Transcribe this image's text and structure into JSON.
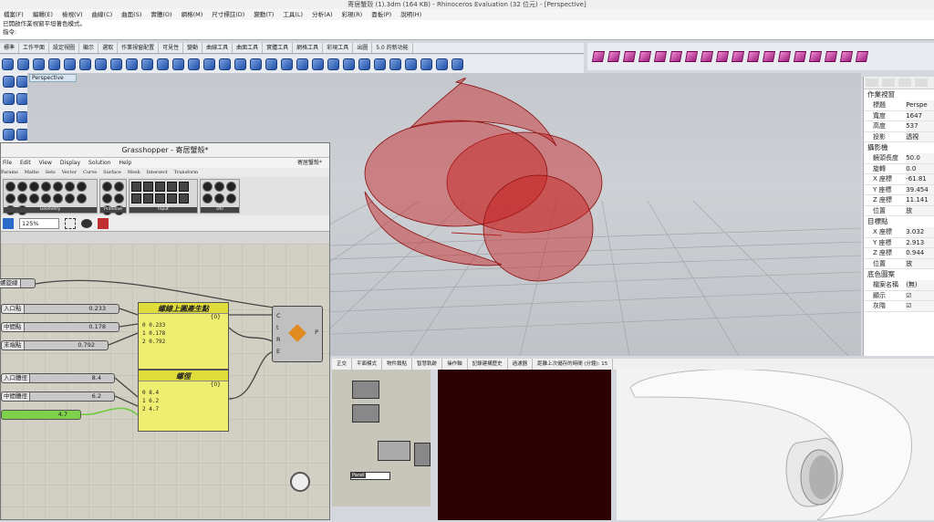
{
  "window": {
    "title": "寄居蟹殼 (1).3dm (164 KB) - Rhinoceros Evaluation (32 位元) - [Perspective]"
  },
  "menu": [
    "檔案(F)",
    "編輯(E)",
    "檢視(V)",
    "曲線(C)",
    "曲面(S)",
    "實體(O)",
    "網格(M)",
    "尺寸標註(D)",
    "變動(T)",
    "工具(L)",
    "分析(A)",
    "彩現(R)",
    "面板(P)",
    "說明(H)"
  ],
  "command": {
    "line1": "已開啟作業視窗平坦著色模式。",
    "prompt": "指令:"
  },
  "toolbar_tabs": [
    "標準",
    "工作平面",
    "設定視圖",
    "顯示",
    "選取",
    "作業視窗配置",
    "可見性",
    "變動",
    "曲線工具",
    "曲面工具",
    "實體工具",
    "網格工具",
    "彩現工具",
    "出圖",
    "5.0 的新功能"
  ],
  "viewport": {
    "label": "Perspective"
  },
  "properties": {
    "section_viewport": "作業視窗",
    "rows1": [
      {
        "k": "標題",
        "v": "Perspe"
      },
      {
        "k": "寬度",
        "v": "1647"
      },
      {
        "k": "高度",
        "v": "537"
      },
      {
        "k": "投影",
        "v": "透視"
      }
    ],
    "section_camera": "攝影機",
    "rows2": [
      {
        "k": "鏡頭長度",
        "v": "50.0"
      },
      {
        "k": "旋轉",
        "v": "0.0"
      },
      {
        "k": "X 座標",
        "v": "-61.81"
      },
      {
        "k": "Y 座標",
        "v": "39.454"
      },
      {
        "k": "Z 座標",
        "v": "11.141"
      },
      {
        "k": "位置",
        "v": "放"
      }
    ],
    "section_target": "目標點",
    "rows3": [
      {
        "k": "X 座標",
        "v": "3.032"
      },
      {
        "k": "Y 座標",
        "v": "2.913"
      },
      {
        "k": "Z 座標",
        "v": "0.944"
      },
      {
        "k": "位置",
        "v": "放"
      }
    ],
    "section_bg": "底色圖案",
    "rows4": [
      {
        "k": "檔案名稱",
        "v": "(無)"
      },
      {
        "k": "顯示",
        "v": "☑"
      },
      {
        "k": "灰階",
        "v": "☑"
      }
    ]
  },
  "grasshopper": {
    "title": "Grasshopper - 寄居蟹殼*",
    "menu": [
      "File",
      "Edit",
      "View",
      "Display",
      "Solution",
      "Help"
    ],
    "doc_name": "寄居蟹殼*",
    "tabs": [
      "Params",
      "Maths",
      "Sets",
      "Vector",
      "Curve",
      "Surface",
      "Mesh",
      "Intersect",
      "Transform"
    ],
    "ribbon_groups": [
      "Geometry",
      "Primitive",
      "Input",
      "Util"
    ],
    "zoom": "125%",
    "sliders": [
      {
        "name": "螺旋線",
        "value": ""
      },
      {
        "name": "入口點",
        "value": "0.233"
      },
      {
        "name": "中間點",
        "value": "0.178"
      },
      {
        "name": "末端點",
        "value": "0.792"
      },
      {
        "name": "入口體徑",
        "value": "8.4"
      },
      {
        "name": "中間體徑",
        "value": "6.2"
      },
      {
        "name": "",
        "value": "4.7"
      }
    ],
    "panel1": {
      "title": "螺線上圓產生點",
      "header": "{0}",
      "lines": [
        "0  0.233",
        "1  0.178",
        "2  0.792"
      ]
    },
    "panel2": {
      "title": "螺徑",
      "header": "{0}",
      "lines": [
        "0  8.4",
        "1  6.2",
        "2  4.7"
      ]
    },
    "construct": {
      "inputs": [
        "C",
        "t",
        "R",
        "E"
      ],
      "output": "P"
    }
  },
  "bottom_tabs": [
    "正交",
    "平面模式",
    "物件鎖點",
    "智慧軌跡",
    "操作軸",
    "記錄建構歷史",
    "過濾器",
    "距離上次儲存的時間 (分鐘): 15"
  ],
  "bottom_panel_label": "Panel"
}
